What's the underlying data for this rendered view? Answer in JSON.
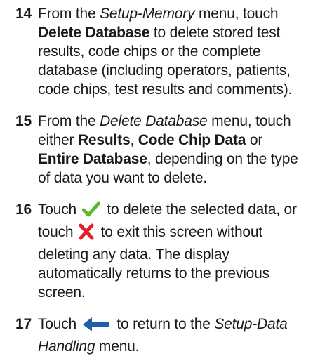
{
  "steps": [
    {
      "number": "14",
      "parts": {
        "a": "From the ",
        "b": "Setup-Memory",
        "c": " menu, touch ",
        "d": "Delete Database",
        "e": " to delete stored test results, code chips or the complete database (including operators, patients, code chips, test results and comments)."
      }
    },
    {
      "number": "15",
      "parts": {
        "a": "From the ",
        "b": "Delete Database",
        "c": " menu, touch either ",
        "d": "Results",
        "e": ", ",
        "f": "Code Chip Data",
        "g": " or ",
        "h": "Entire Database",
        "i": ", depending on the type of data you want to delete."
      }
    },
    {
      "number": "16",
      "parts": {
        "a": "Touch ",
        "b": " to delete the selected data, or touch ",
        "c": " to exit this screen without deleting any data. The display automatically returns to the previous screen."
      },
      "icons": [
        "checkmark-icon",
        "cross-icon"
      ]
    },
    {
      "number": "17",
      "parts": {
        "a": "Touch ",
        "b": " to return to the ",
        "c": "Setup-Data Handling",
        "d": " menu."
      },
      "icons": [
        "back-arrow-icon"
      ]
    }
  ],
  "colors": {
    "check": "#5cb82e",
    "cross": "#e0202a",
    "arrow": "#1f5fa8",
    "text": "#1a1a1a"
  }
}
